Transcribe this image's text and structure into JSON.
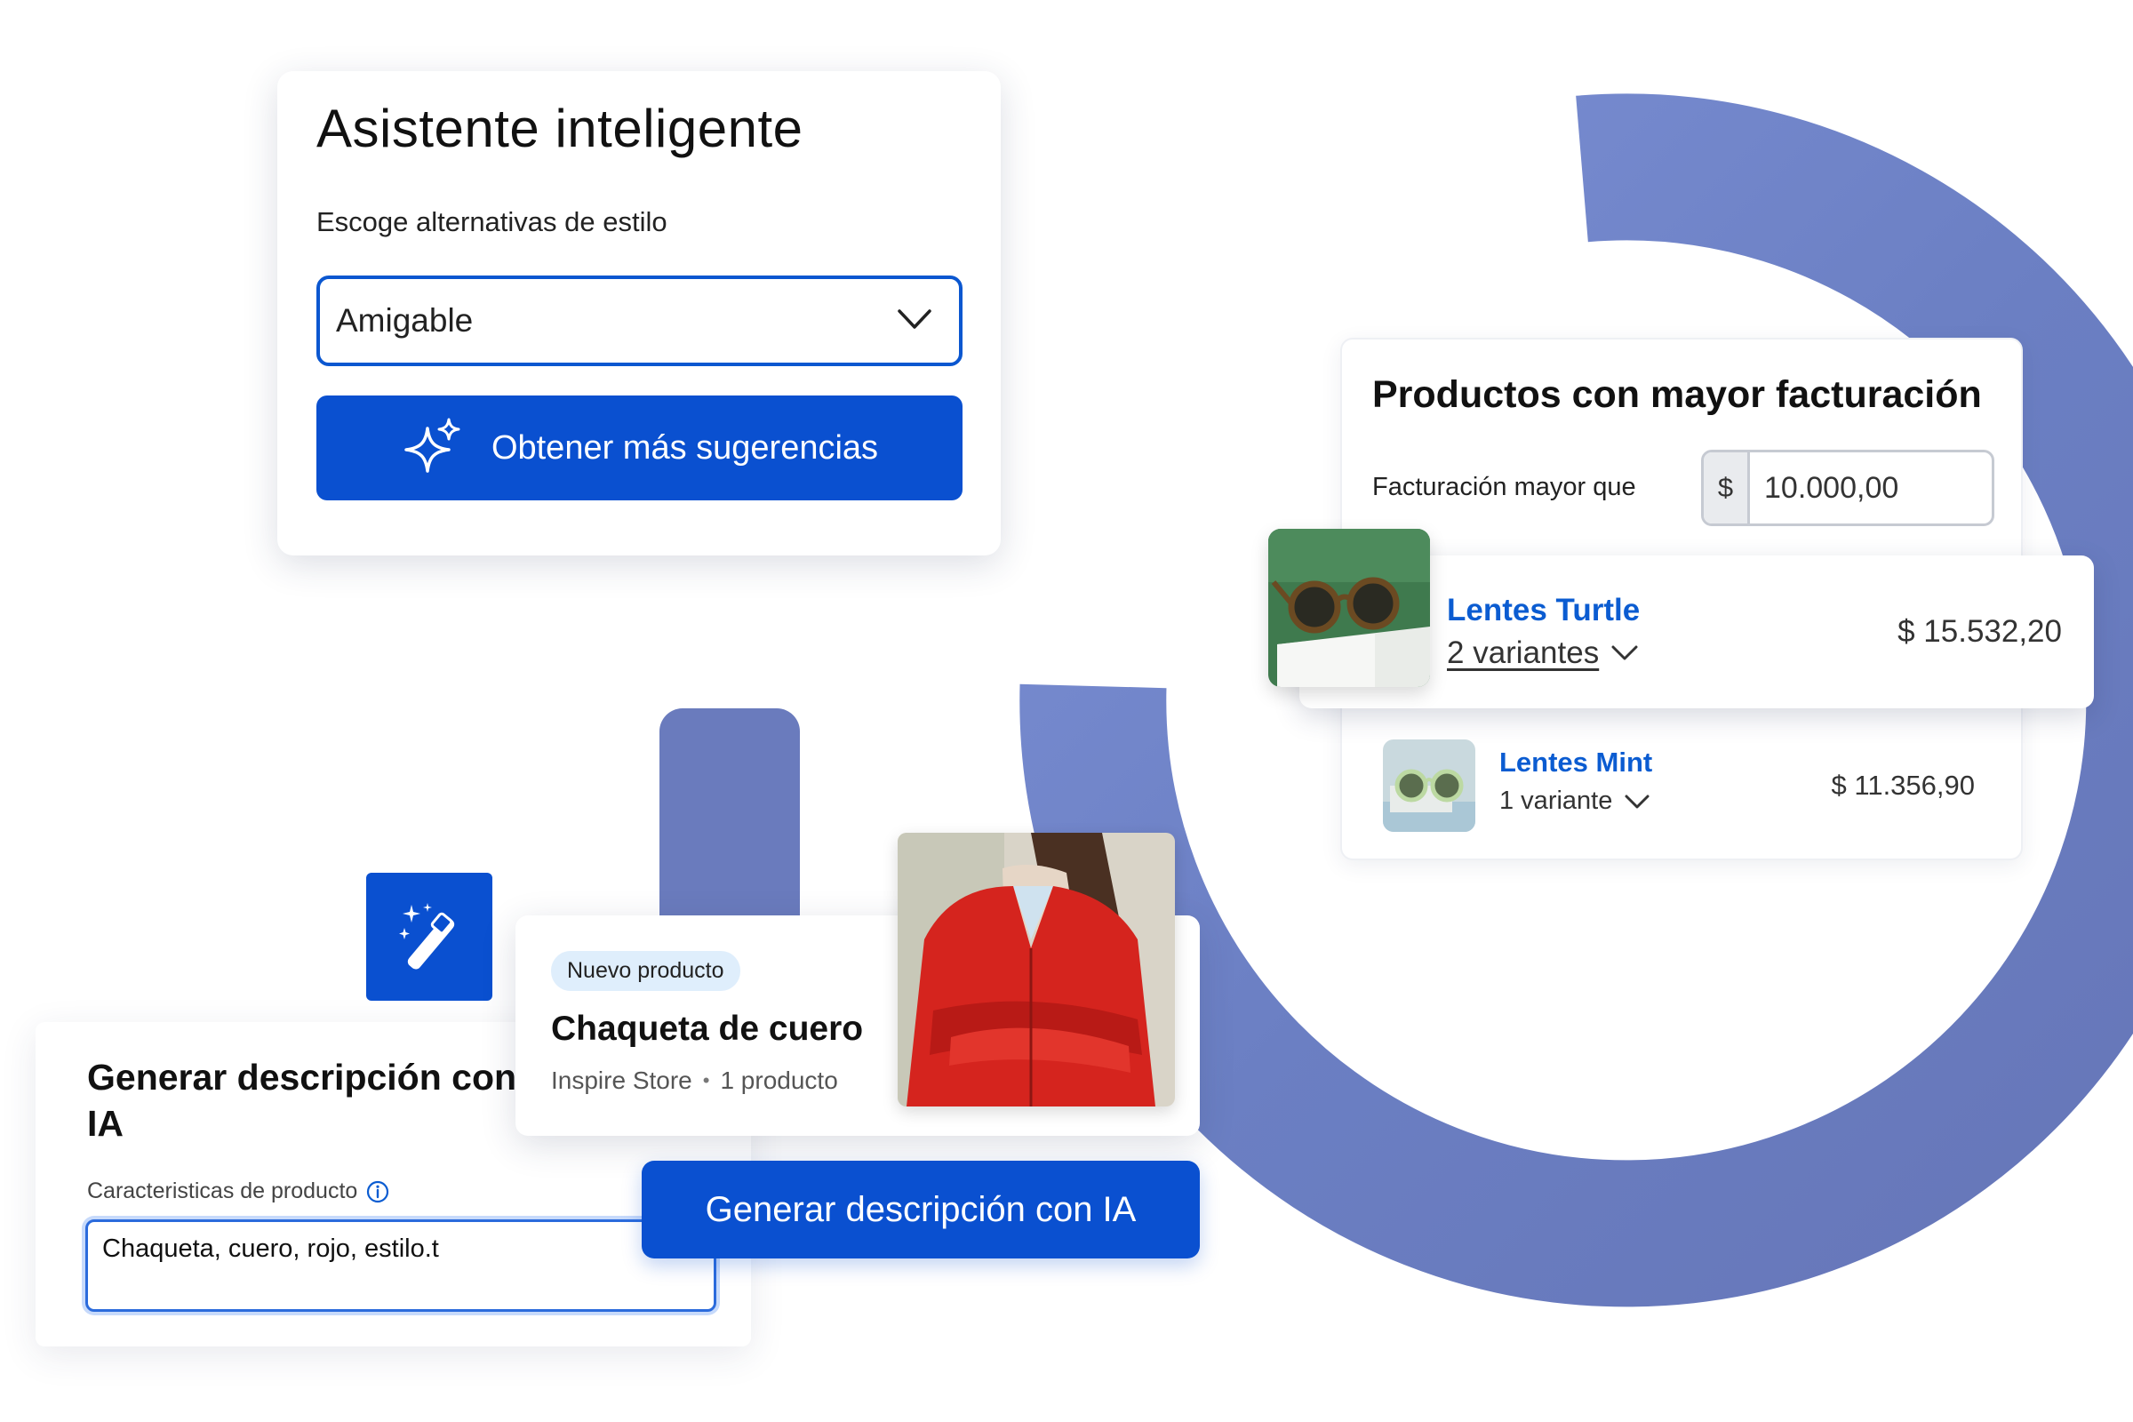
{
  "assistant": {
    "title": "Asistente inteligente",
    "subtitle": "Escoge alternativas de estilo",
    "style_select": {
      "value": "Amigable"
    },
    "suggest_button": "Obtener más sugerencias"
  },
  "top_products": {
    "title": "Productos con mayor facturación",
    "filter_label": "Facturación mayor que",
    "currency_prefix": "$",
    "threshold_value": "10.000,00",
    "items": [
      {
        "name": "Lentes Turtle",
        "variants": "2 variantes",
        "price": "$ 15.532,20"
      },
      {
        "name": "Lentes Mint",
        "variants": "1 variante",
        "price": "$ 11.356,90"
      }
    ]
  },
  "generator": {
    "title": "Generar descripción con IA",
    "field_label": "Caracteristicas de producto",
    "field_value": "Chaqueta, cuero, rojo, estilo.t",
    "button": "Generar descripción con IA"
  },
  "product_card": {
    "badge": "Nuevo producto",
    "name": "Chaqueta de cuero",
    "store": "Inspire Store",
    "separator": "•",
    "count": "1 producto"
  },
  "colors": {
    "primary": "#0a50d0",
    "link": "#0b5cd1",
    "ring": "#6f82c4",
    "badge_bg": "#dfeefc"
  }
}
